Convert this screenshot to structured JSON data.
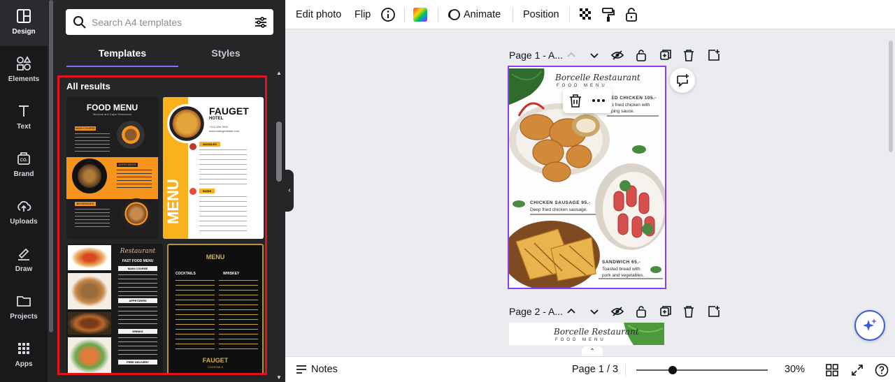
{
  "rail": {
    "items": [
      {
        "label": "Design",
        "icon": "design-icon"
      },
      {
        "label": "Elements",
        "icon": "elements-icon"
      },
      {
        "label": "Text",
        "icon": "text-icon"
      },
      {
        "label": "Brand",
        "icon": "brand-icon"
      },
      {
        "label": "Uploads",
        "icon": "uploads-icon"
      },
      {
        "label": "Draw",
        "icon": "draw-icon"
      },
      {
        "label": "Projects",
        "icon": "folder-icon"
      },
      {
        "label": "Apps",
        "icon": "apps-icon"
      }
    ]
  },
  "panel": {
    "search_placeholder": "Search A4 templates",
    "tabs": [
      "Templates",
      "Styles"
    ],
    "results_title": "All results",
    "templates": [
      {
        "title": "FOOD MENU",
        "subtitle": "Mexican and Cajun Restaurant",
        "sections": [
          "MAIN COURSE",
          "APPETIZERS",
          "BEVERAGES"
        ]
      },
      {
        "title": "FAUGET",
        "subtitle": "HOTEL",
        "side": "MENU",
        "phone": "+123 456 7890",
        "website": "www.reallygreatsite.com",
        "sections": [
          "NOODLES",
          "SUSHI"
        ]
      },
      {
        "script": "Restaurant",
        "title": "FAST FOOD MENU",
        "sections": [
          "MAIN COURSE",
          "APPETIZERS",
          "DRINKS",
          "FREE DELIVERY"
        ]
      },
      {
        "title": "MENU",
        "sections": [
          "COCKTAILS",
          "WHISKEY"
        ],
        "footer": "FAUGET",
        "footer_sub": "COCKTAILS"
      }
    ]
  },
  "toolbar": {
    "edit_photo": "Edit photo",
    "flip": "Flip",
    "animate": "Animate",
    "position": "Position"
  },
  "pages": {
    "page1_label": "Page 1 - A...",
    "page2_label": "Page 2 - A..."
  },
  "canvas": {
    "script_title": "Borcelle Restaurant",
    "subtitle": "FOOD MENU",
    "item1_title": "ED CHICKEN 105.-",
    "item1_desc_a": "p fried chicken with",
    "item1_desc_b": "ping sauce.",
    "item2_title": "CHICKEN SAUSAGE 95.-",
    "item2_desc": "Deep fried chicken sausage.",
    "item3_title": "SANDWICH 65.-",
    "item3_desc_a": "Toasted bread with",
    "item3_desc_b": "pork and vegetables."
  },
  "bottom": {
    "notes": "Notes",
    "page_indicator": "Page 1 / 3",
    "zoom": "30%"
  },
  "colors": {
    "accent": "#8b3dff",
    "highlight": "#e0141a",
    "panel_bg": "#252627",
    "rail_bg": "#18191b"
  }
}
